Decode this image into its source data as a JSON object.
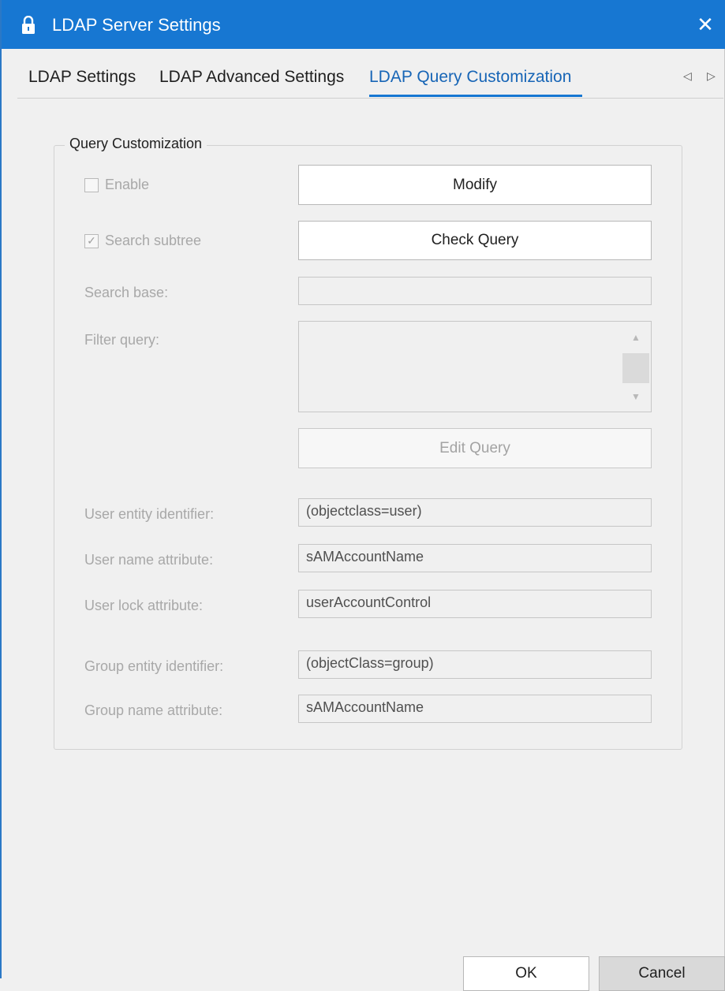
{
  "window": {
    "title": "LDAP Server Settings",
    "close_label": "✕"
  },
  "tabs": [
    {
      "label": "LDAP Settings"
    },
    {
      "label": "LDAP Advanced Settings"
    },
    {
      "label": "LDAP Query Customization"
    }
  ],
  "tab_scroll": {
    "left": "◁",
    "right": "▷"
  },
  "group": {
    "legend": "Query Customization"
  },
  "enable": {
    "label": "Enable",
    "checked": false
  },
  "search_subtree": {
    "label": "Search subtree",
    "checked": true,
    "check_glyph": "✓"
  },
  "buttons": {
    "modify": "Modify",
    "check_query": "Check Query",
    "edit_query": "Edit Query"
  },
  "search_base": {
    "label": "Search base:",
    "value": ""
  },
  "filter_query": {
    "label": "Filter query:",
    "value": ""
  },
  "scrollbar": {
    "up": "▲",
    "down": "▼"
  },
  "fields": {
    "user_entity": {
      "label": "User entity identifier:",
      "value": "(objectclass=user)"
    },
    "user_name": {
      "label": "User name attribute:",
      "value": "sAMAccountName"
    },
    "user_lock": {
      "label": "User lock attribute:",
      "value": "userAccountControl"
    },
    "group_entity": {
      "label": "Group entity identifier:",
      "value": "(objectClass=group)"
    },
    "group_name": {
      "label": "Group name attribute:",
      "value": "sAMAccountName"
    }
  },
  "footer": {
    "ok": "OK",
    "cancel": "Cancel"
  },
  "colors": {
    "titlebar": "#1777d2",
    "accent": "#1765b6"
  },
  "icons": {
    "title": "lock-icon"
  }
}
